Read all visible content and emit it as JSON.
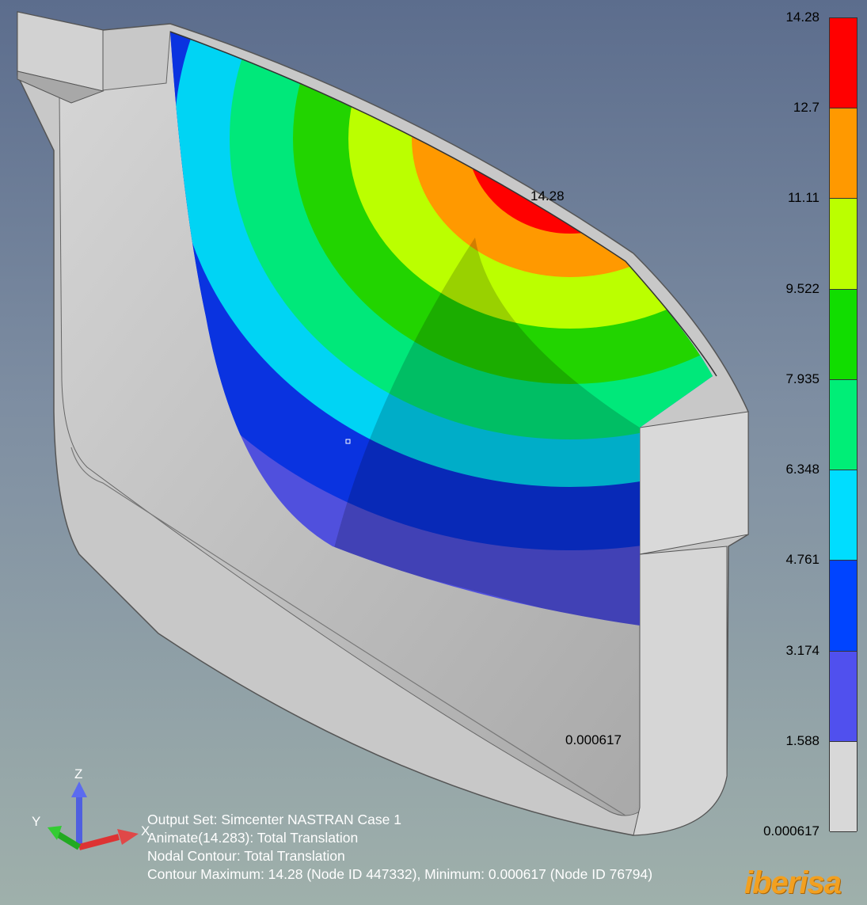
{
  "legend": {
    "ticks": [
      "14.28",
      "12.7",
      "11.11",
      "9.522",
      "7.935",
      "6.348",
      "4.761",
      "3.174",
      "1.588",
      "0.000617"
    ],
    "colors": [
      "#ff0000",
      "#ff9900",
      "#bbff00",
      "#11dd00",
      "#00ee77",
      "#00ddff",
      "#0044ff",
      "#5050ee",
      "#d8d8d8"
    ]
  },
  "annotations": {
    "max_value": "14.28",
    "min_value": "0.000617"
  },
  "info": {
    "line1": "Output Set: Simcenter NASTRAN Case 1",
    "line2": "Animate(14.283): Total Translation",
    "line3": "Nodal Contour: Total Translation",
    "line4": "Contour Maximum: 14.28 (Node ID 447332), Minimum: 0.000617 (Node ID 76794)"
  },
  "triad": {
    "x": "X",
    "y": "Y",
    "z": "Z"
  },
  "logo": "iberisa"
}
